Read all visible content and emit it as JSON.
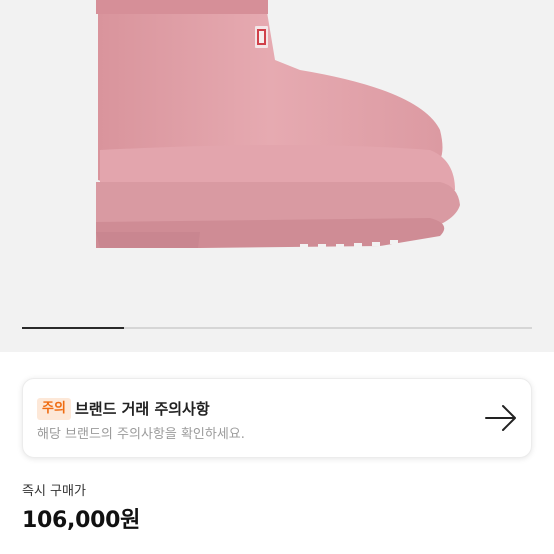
{
  "product": {
    "image_alt": "pink rain boot",
    "image_color": "#e3a6ad",
    "gallery_progress": 0.2
  },
  "notice": {
    "badge": "주의",
    "title": "브랜드 거래 주의사항",
    "description": "해당 브랜드의 주의사항을 확인하세요.",
    "arrow_icon": "arrow-right-icon"
  },
  "price": {
    "label": "즉시 구매가",
    "value": "106,000원"
  }
}
